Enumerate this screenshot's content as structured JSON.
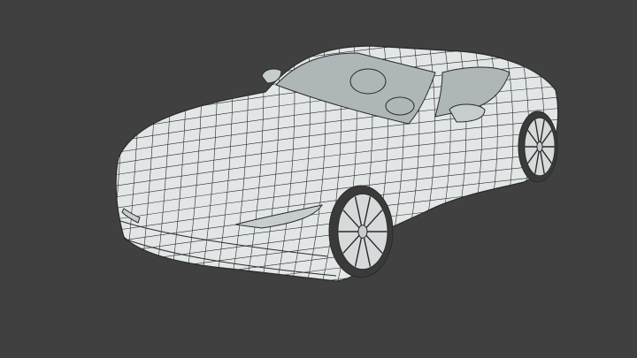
{
  "viewport": {
    "background_color": "#404040",
    "model": {
      "subject": "sports-car-wireframe",
      "surface_color": "#e2e6e6",
      "shadow_color": "#c7cdcd",
      "wire_color": "#2a2a2a",
      "glass_color": "#aeb6b8",
      "tire_color": "#3a3a3a",
      "rim_color": "#d6dada"
    }
  }
}
